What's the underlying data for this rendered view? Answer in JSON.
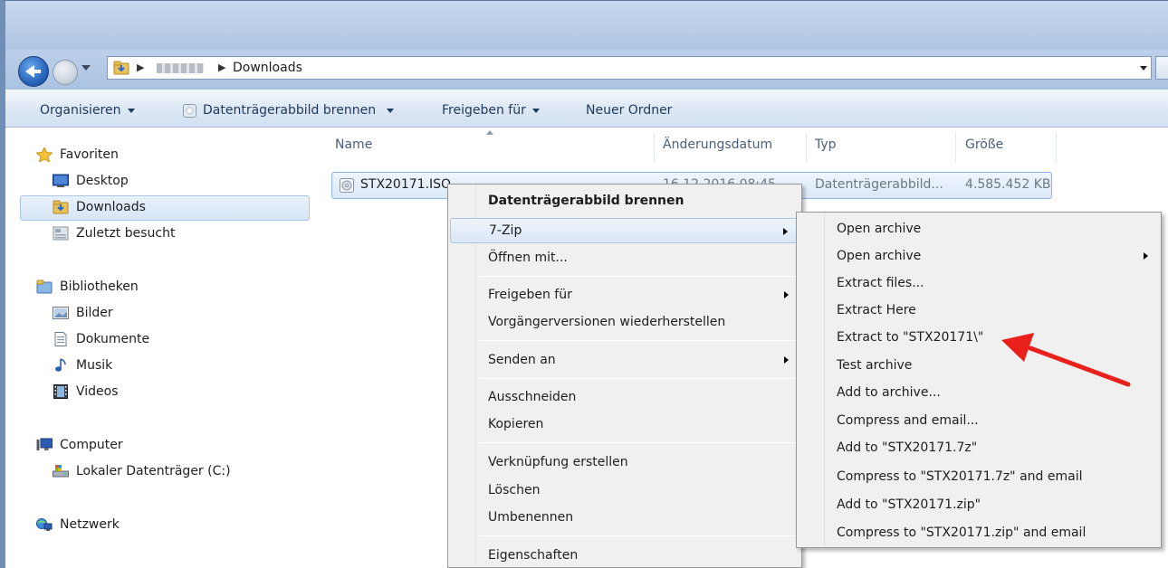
{
  "address": {
    "blurred_segment": "PC-NAME",
    "current": "Downloads"
  },
  "toolbar": {
    "organize": "Organisieren",
    "burn": "Datenträgerabbild brennen",
    "share": "Freigeben für",
    "new_folder": "Neuer Ordner"
  },
  "sidebar": {
    "favorites": "Favoriten",
    "desktop": "Desktop",
    "downloads": "Downloads",
    "recent": "Zuletzt besucht",
    "libraries": "Bibliotheken",
    "pictures": "Bilder",
    "documents": "Dokumente",
    "music": "Musik",
    "videos": "Videos",
    "computer": "Computer",
    "local_disk": "Lokaler Datenträger (C:)",
    "network": "Netzwerk"
  },
  "columns": {
    "name": "Name",
    "date": "Änderungsdatum",
    "type": "Typ",
    "size": "Größe"
  },
  "file": {
    "name": "STX20171.ISO",
    "date": "16.12.2016 08:45",
    "type": "Datenträgerabbild...",
    "size": "4.585.452 KB"
  },
  "context_menu": {
    "burn": "Datenträgerabbild brennen",
    "sevenzip": "7-Zip",
    "open_with": "Öffnen mit...",
    "share": "Freigeben für",
    "restore": "Vorgängerversionen wiederherstellen",
    "send_to": "Senden an",
    "cut": "Ausschneiden",
    "copy": "Kopieren",
    "shortcut": "Verknüpfung erstellen",
    "delete": "Löschen",
    "rename": "Umbenennen",
    "properties": "Eigenschaften"
  },
  "submenu": {
    "open_archive": "Open archive",
    "open_archive_sub": "Open archive",
    "extract_files": "Extract files...",
    "extract_here": "Extract Here",
    "extract_to": "Extract to \"STX20171\\\"",
    "test_archive": "Test archive",
    "add_to_archive": "Add to archive...",
    "compress_email": "Compress and email...",
    "add_7z": "Add to \"STX20171.7z\"",
    "compress_7z_email": "Compress to \"STX20171.7z\" and email",
    "add_zip": "Add to \"STX20171.zip\"",
    "compress_zip_email": "Compress to \"STX20171.zip\" and email"
  },
  "colors": {
    "annotation_arrow": "#e8211d",
    "selection_border": "#8fb4e2",
    "toolbar_text": "#1e395b"
  }
}
